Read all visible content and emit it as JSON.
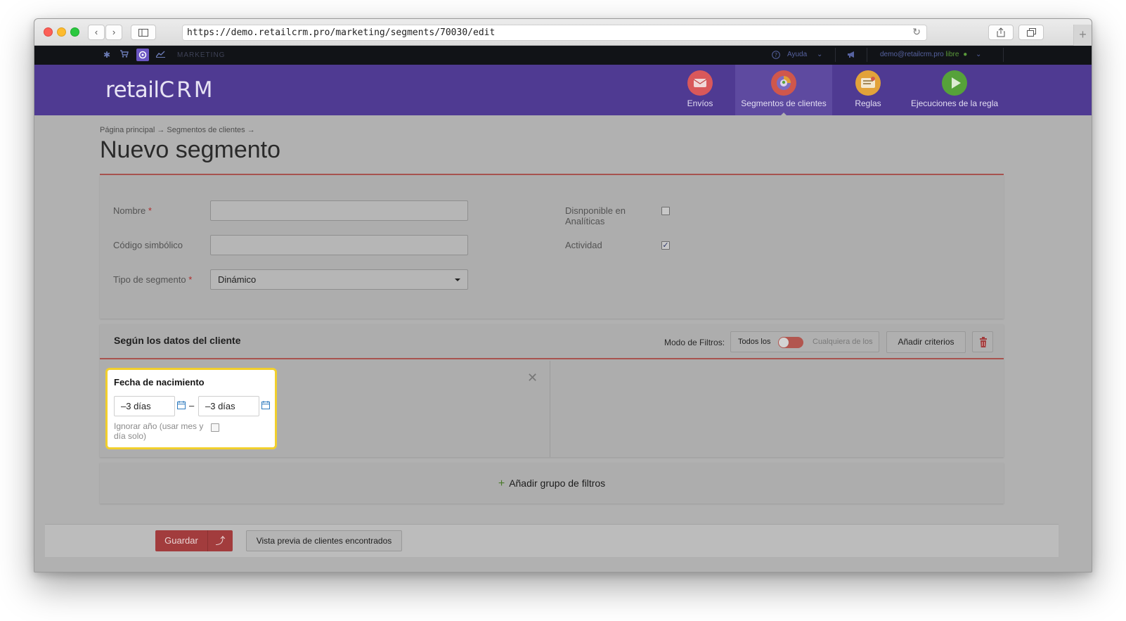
{
  "browser": {
    "url": "https://demo.retailcrm.pro/marketing/segments/70030/edit",
    "back_icon": "chevron-left-icon",
    "forward_icon": "chevron-right-icon",
    "sidebar_icon": "sidebar-icon",
    "reload_icon": "reload-icon",
    "share_icon": "share-icon",
    "tabs_icon": "tabs-icon",
    "new_tab_icon": "plus-icon"
  },
  "topbar": {
    "section_label": "MARKETING",
    "help_label": "Ayuda",
    "user_email": "demo@retailcrm.pro",
    "user_plan": "libre",
    "icons": [
      "gear-icon",
      "cart-icon",
      "target-icon",
      "chart-icon",
      "megaphone-icon",
      "help-icon"
    ]
  },
  "header": {
    "logo_text": "retail",
    "logo_crm": "CRM",
    "nav": [
      {
        "label": "Envíos",
        "icon": "mail-icon",
        "color": "#e05a5a"
      },
      {
        "label": "Segmentos de clientes",
        "icon": "segments-icon",
        "color": "#d8584a",
        "active": true
      },
      {
        "label": "Reglas",
        "icon": "rules-icon",
        "color": "#e7a83a"
      },
      {
        "label": "Ejecuciones de la regla",
        "icon": "play-icon",
        "color": "#58a43c"
      }
    ]
  },
  "page": {
    "breadcrumb": "Página principal → Segmentos de clientes →",
    "title": "Nuevo segmento"
  },
  "form": {
    "name_label": "Nombre",
    "name_value": "",
    "code_label": "Código simbólico",
    "code_value": "",
    "type_label": "Tipo de segmento",
    "type_value": "Dinámico",
    "required_mark": "*",
    "analytics_label": "Disnponible en Analíticas",
    "analytics_checked": false,
    "active_label": "Actividad",
    "active_checked": true,
    "check_mark": "✓"
  },
  "filters": {
    "title": "Según los datos del cliente",
    "mode_label": "Modo de Filtros:",
    "mode_all": "Todos los",
    "mode_any": "Cualquiera de los",
    "add_criteria": "Añadir criterios",
    "delete_icon": "trash-icon",
    "close_icon": "close-icon",
    "criterion": {
      "title": "Fecha de nacimiento",
      "from_value": "–3 días",
      "to_value": "–3 días",
      "separator": "–",
      "ignore_year_label": "Ignorar año (usar mes y día solo)",
      "ignore_year_checked": false,
      "calendar_icon": "calendar-icon"
    },
    "add_group": "Añadir grupo de filtros",
    "add_group_plus": "+"
  },
  "footer": {
    "save_label": "Guardar",
    "save_arrow": "⤴",
    "preview_label": "Vista previa de clientes encontrados"
  }
}
